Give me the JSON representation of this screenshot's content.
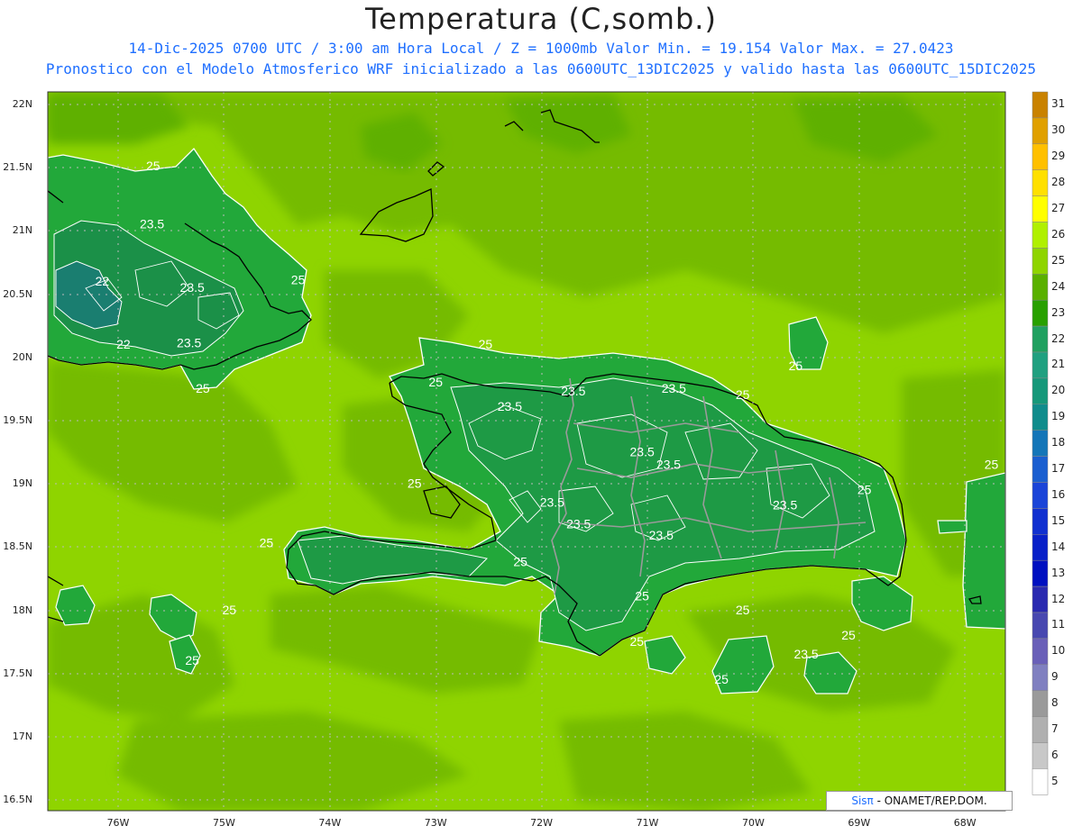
{
  "title": "Temperatura (C,somb.)",
  "subtitle1": "14-Dic-2025  0700 UTC / 3:00 am Hora Local / Z = 1000mb    Valor Min. = 19.154  Valor Max. = 27.0423",
  "subtitle2": "Pronostico con el Modelo Atmosferico WRF inicializado a las 0600UTC_13DIC2025 y valido hasta las  0600UTC_15DIC2025",
  "credit_prefix": "Sis",
  "credit_symbol": "π",
  "credit_suffix": " - ONAMET/REP.DOM.",
  "colors": {
    "ocean_light": "#8fd400",
    "ocean_mid": "#74bb00",
    "ocean_dark": "#5aab00",
    "land_green": "#2fa83a",
    "land_dark": "#1f8f3a",
    "contour": "#ffffff",
    "coast": "#000000",
    "border": "#999999"
  },
  "y_axis": [
    "22N",
    "21.5N",
    "21N",
    "20.5N",
    "20N",
    "19.5N",
    "19N",
    "18.5N",
    "18N",
    "17.5N",
    "17N",
    "16.5N"
  ],
  "x_axis": [
    "76W",
    "75W",
    "74W",
    "73W",
    "72W",
    "71W",
    "70W",
    "69W",
    "68W"
  ],
  "colorbar": {
    "labels": [
      "31",
      "30",
      "29",
      "28",
      "27",
      "26",
      "25",
      "24",
      "23",
      "22",
      "21",
      "20",
      "19",
      "18",
      "17",
      "16",
      "15",
      "14",
      "13",
      "12",
      "11",
      "10",
      "9",
      "8",
      "7",
      "6",
      "5"
    ],
    "colors": [
      "#c98200",
      "#e0a000",
      "#ffc000",
      "#ffe000",
      "#ffff00",
      "#b0f000",
      "#8fd400",
      "#5ab000",
      "#28a000",
      "#20a060",
      "#20a080",
      "#16987a",
      "#108c8c",
      "#1476b8",
      "#1a5fd0",
      "#1a44d8",
      "#1030d0",
      "#0820c8",
      "#0010c0",
      "#2a2ab0",
      "#4848b0",
      "#6a60b8",
      "#8080c0",
      "#9a9a9a",
      "#b0b0b0",
      "#c8c8c8",
      "#ffffff"
    ]
  },
  "contour_labels": [
    {
      "text": "25",
      "lon": -75.67,
      "lat": 21.48
    },
    {
      "text": "23.5",
      "lon": -75.68,
      "lat": 21.02
    },
    {
      "text": "22",
      "lon": -76.15,
      "lat": 20.57
    },
    {
      "text": "23.5",
      "lon": -75.3,
      "lat": 20.52
    },
    {
      "text": "25",
      "lon": -74.3,
      "lat": 20.58
    },
    {
      "text": "22",
      "lon": -75.95,
      "lat": 20.07
    },
    {
      "text": "23.5",
      "lon": -75.33,
      "lat": 20.08
    },
    {
      "text": "25",
      "lon": -75.2,
      "lat": 19.72
    },
    {
      "text": "25",
      "lon": -72.53,
      "lat": 20.07
    },
    {
      "text": "25",
      "lon": -73.0,
      "lat": 19.77
    },
    {
      "text": "23.5",
      "lon": -72.3,
      "lat": 19.58
    },
    {
      "text": "23.5",
      "lon": -71.7,
      "lat": 19.7
    },
    {
      "text": "23.5",
      "lon": -70.75,
      "lat": 19.72
    },
    {
      "text": "25",
      "lon": -70.1,
      "lat": 19.67
    },
    {
      "text": "25",
      "lon": -69.6,
      "lat": 19.9
    },
    {
      "text": "23.5",
      "lon": -71.05,
      "lat": 19.22
    },
    {
      "text": "23.5",
      "lon": -70.8,
      "lat": 19.12
    },
    {
      "text": "25",
      "lon": -73.2,
      "lat": 18.97
    },
    {
      "text": "23.5",
      "lon": -71.9,
      "lat": 18.82
    },
    {
      "text": "23.5",
      "lon": -71.65,
      "lat": 18.65
    },
    {
      "text": "23.5",
      "lon": -70.87,
      "lat": 18.56
    },
    {
      "text": "23.5",
      "lon": -69.7,
      "lat": 18.8
    },
    {
      "text": "25",
      "lon": -68.95,
      "lat": 18.92
    },
    {
      "text": "25",
      "lon": -67.75,
      "lat": 19.12
    },
    {
      "text": "25",
      "lon": -74.6,
      "lat": 18.5
    },
    {
      "text": "25",
      "lon": -72.2,
      "lat": 18.35
    },
    {
      "text": "25",
      "lon": -74.95,
      "lat": 17.97
    },
    {
      "text": "25",
      "lon": -71.05,
      "lat": 18.08
    },
    {
      "text": "25",
      "lon": -70.1,
      "lat": 17.97
    },
    {
      "text": "25",
      "lon": -71.1,
      "lat": 17.72
    },
    {
      "text": "25",
      "lon": -69.1,
      "lat": 17.77
    },
    {
      "text": "25",
      "lon": -75.3,
      "lat": 17.57
    },
    {
      "text": "23.5",
      "lon": -69.5,
      "lat": 17.62
    },
    {
      "text": "25",
      "lon": -70.3,
      "lat": 17.42
    }
  ]
}
